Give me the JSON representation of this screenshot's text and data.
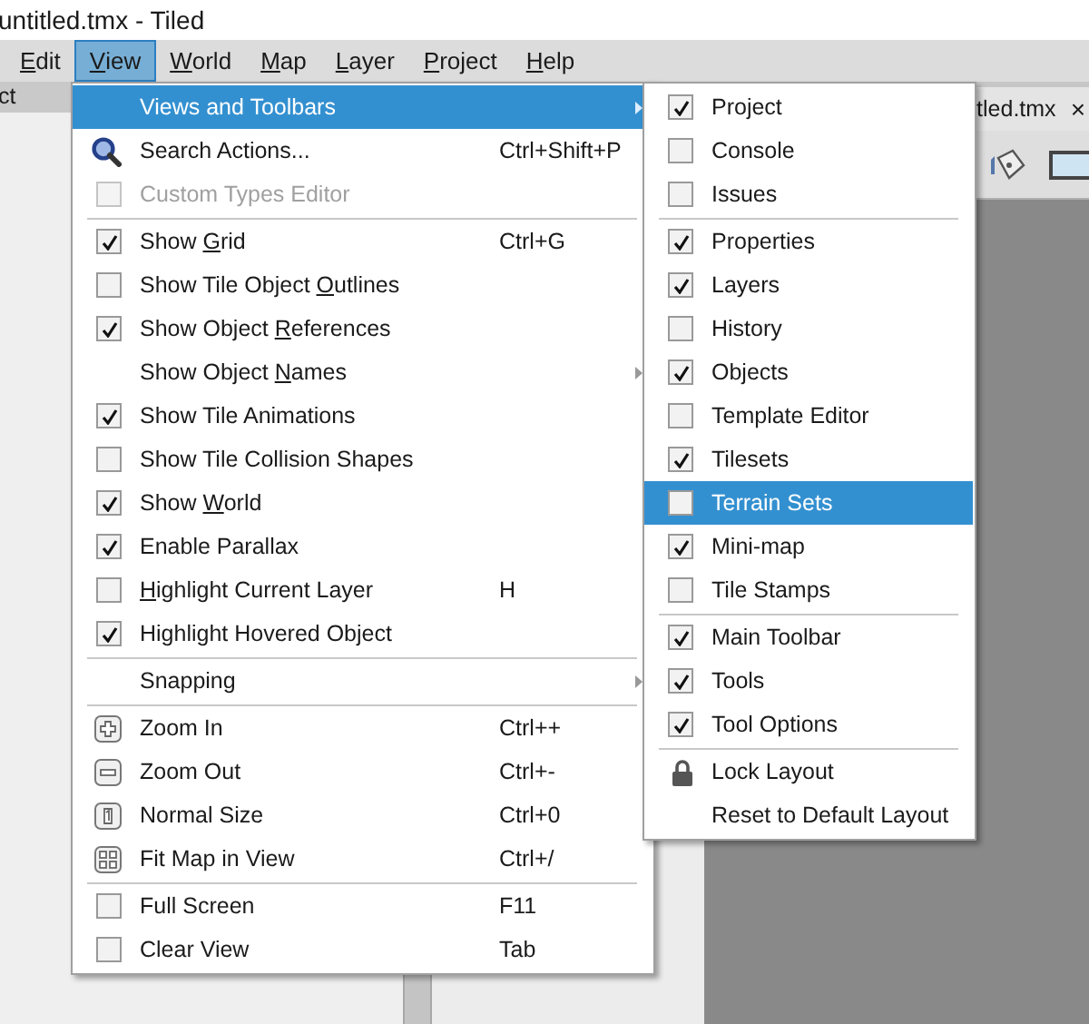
{
  "window": {
    "title": "untitled.tmx - Tiled"
  },
  "menubar": [
    {
      "accel": "E",
      "post": "dit",
      "selected": false
    },
    {
      "accel": "V",
      "post": "iew",
      "selected": true
    },
    {
      "accel": "W",
      "post": "orld",
      "selected": false
    },
    {
      "accel": "M",
      "post": "ap",
      "selected": false
    },
    {
      "accel": "L",
      "post": "ayer",
      "selected": false
    },
    {
      "accel": "P",
      "post": "roject",
      "selected": false
    },
    {
      "accel": "H",
      "post": "elp",
      "selected": false
    }
  ],
  "left_panel": {
    "title": "ct"
  },
  "document_tab": {
    "title": "tled.tmx",
    "close": "×"
  },
  "view_menu": [
    {
      "kind": "submenu",
      "label": "Views and Toolbars",
      "selected": true
    },
    {
      "kind": "search",
      "label": "Search Actions...",
      "shortcut": "Ctrl+Shift+P",
      "selected": false
    },
    {
      "kind": "check",
      "label": "Custom Types Editor",
      "checked": false,
      "disabled": true,
      "selected": false
    },
    {
      "kind": "separator"
    },
    {
      "kind": "check",
      "pre": "Show ",
      "accel": "G",
      "post": "rid",
      "shortcut": "Ctrl+G",
      "checked": true,
      "selected": false
    },
    {
      "kind": "check",
      "pre": "Show Tile Object ",
      "accel": "O",
      "post": "utlines",
      "checked": false,
      "selected": false
    },
    {
      "kind": "check",
      "pre": "Show Object ",
      "accel": "R",
      "post": "eferences",
      "checked": true,
      "selected": false
    },
    {
      "kind": "submenu",
      "pre": "Show Object ",
      "accel": "N",
      "post": "ames",
      "selected": false
    },
    {
      "kind": "check",
      "label": "Show Tile Animations",
      "checked": true,
      "selected": false
    },
    {
      "kind": "check",
      "label": "Show Tile Collision Shapes",
      "checked": false,
      "selected": false
    },
    {
      "kind": "check",
      "pre": "Show ",
      "accel": "W",
      "post": "orld",
      "checked": true,
      "selected": false
    },
    {
      "kind": "check",
      "label": "Enable Parallax",
      "checked": true,
      "selected": false
    },
    {
      "kind": "check",
      "accel": "H",
      "post": "ighlight Current Layer",
      "shortcut": "H",
      "checked": false,
      "selected": false
    },
    {
      "kind": "check",
      "label": "Highlight Hovered Object",
      "checked": true,
      "selected": false
    },
    {
      "kind": "separator"
    },
    {
      "kind": "submenu",
      "label": "Snapping",
      "selected": false
    },
    {
      "kind": "separator"
    },
    {
      "kind": "zoomin",
      "label": "Zoom In",
      "shortcut": "Ctrl++",
      "selected": false
    },
    {
      "kind": "zoomout",
      "label": "Zoom Out",
      "shortcut": "Ctrl+-",
      "selected": false
    },
    {
      "kind": "normalsize",
      "label": "Normal Size",
      "shortcut": "Ctrl+0",
      "selected": false
    },
    {
      "kind": "fit",
      "label": "Fit Map in View",
      "shortcut": "Ctrl+/",
      "selected": false
    },
    {
      "kind": "separator"
    },
    {
      "kind": "check",
      "label": "Full Screen",
      "shortcut": "F11",
      "checked": false,
      "selected": false
    },
    {
      "kind": "check",
      "label": "Clear View",
      "shortcut": "Tab",
      "checked": false,
      "selected": false
    }
  ],
  "views_submenu": [
    {
      "kind": "check",
      "label": "Project",
      "checked": true,
      "selected": false
    },
    {
      "kind": "check",
      "label": "Console",
      "checked": false,
      "selected": false
    },
    {
      "kind": "check",
      "label": "Issues",
      "checked": false,
      "selected": false
    },
    {
      "kind": "separator"
    },
    {
      "kind": "check",
      "label": "Properties",
      "checked": true,
      "selected": false
    },
    {
      "kind": "check",
      "label": "Layers",
      "checked": true,
      "selected": false
    },
    {
      "kind": "check",
      "label": "History",
      "checked": false,
      "selected": false
    },
    {
      "kind": "check",
      "label": "Objects",
      "checked": true,
      "selected": false
    },
    {
      "kind": "check",
      "label": "Template Editor",
      "checked": false,
      "selected": false
    },
    {
      "kind": "check",
      "label": "Tilesets",
      "checked": true,
      "selected": false
    },
    {
      "kind": "check",
      "label": "Terrain Sets",
      "checked": false,
      "selected": true
    },
    {
      "kind": "check",
      "label": "Mini-map",
      "checked": true,
      "selected": false
    },
    {
      "kind": "check",
      "label": "Tile Stamps",
      "checked": false,
      "selected": false
    },
    {
      "kind": "separator"
    },
    {
      "kind": "check",
      "label": "Main Toolbar",
      "checked": true,
      "selected": false
    },
    {
      "kind": "check",
      "label": "Tools",
      "checked": true,
      "selected": false
    },
    {
      "kind": "check",
      "label": "Tool Options",
      "checked": true,
      "selected": false
    },
    {
      "kind": "separator"
    },
    {
      "kind": "lock",
      "label": "Lock Layout",
      "selected": false
    },
    {
      "kind": "plain",
      "label": "Reset to Default Layout",
      "selected": false
    }
  ]
}
